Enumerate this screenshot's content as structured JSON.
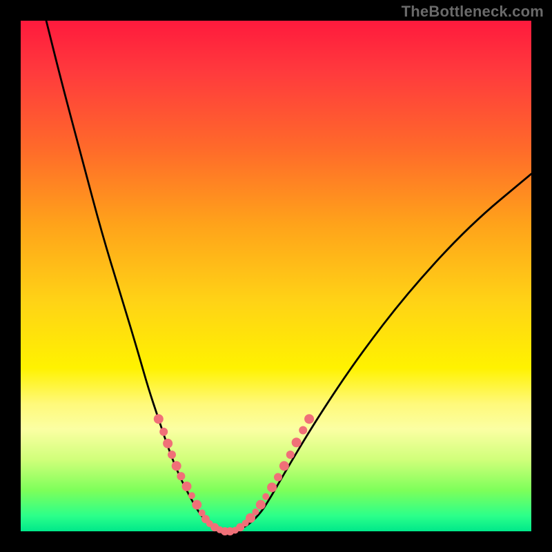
{
  "watermark": "TheBottleneck.com",
  "colors": {
    "background": "#000000",
    "curve": "#000000",
    "marker_fill": "#f07078",
    "gradient_top": "#ff1a3d",
    "gradient_bottom": "#00e88a"
  },
  "chart_data": {
    "type": "line",
    "title": "",
    "xlabel": "",
    "ylabel": "",
    "xlim": [
      0,
      100
    ],
    "ylim": [
      0,
      100
    ],
    "curve": {
      "x": [
        5,
        8,
        12,
        16,
        20,
        23,
        25,
        27,
        29,
        31,
        33,
        35,
        36.5,
        38,
        40,
        42,
        44,
        46,
        48,
        52,
        58,
        66,
        76,
        88,
        100
      ],
      "y": [
        100,
        88,
        73,
        58,
        45,
        35,
        28,
        22,
        16,
        11,
        7,
        3.5,
        1.8,
        0.8,
        0,
        0,
        0.9,
        2.5,
        5,
        12,
        22,
        34,
        47,
        60,
        70
      ]
    },
    "markers": {
      "x": [
        27,
        28,
        28.8,
        29.6,
        30.5,
        31.4,
        32.5,
        33.5,
        34.5,
        35.5,
        36.2,
        37,
        38,
        39,
        40,
        41,
        42,
        43,
        44,
        45,
        46,
        47,
        48,
        49.2,
        50.4,
        51.6,
        52.8,
        54,
        55.3,
        56.5
      ],
      "y": [
        22,
        19.5,
        17.2,
        15,
        12.8,
        10.8,
        8.8,
        7,
        5.2,
        3.6,
        2.4,
        1.5,
        0.8,
        0.3,
        0,
        0,
        0.2,
        0.8,
        1.6,
        2.6,
        3.8,
        5.2,
        6.8,
        8.6,
        10.6,
        12.8,
        15,
        17.4,
        19.8,
        22
      ],
      "r": [
        7,
        6,
        7,
        6,
        7,
        6,
        7,
        5,
        7,
        5,
        6,
        5,
        6,
        5,
        6,
        6,
        5,
        6,
        5,
        7,
        5,
        7,
        5,
        7,
        6,
        7,
        6,
        7,
        6,
        7
      ]
    }
  }
}
